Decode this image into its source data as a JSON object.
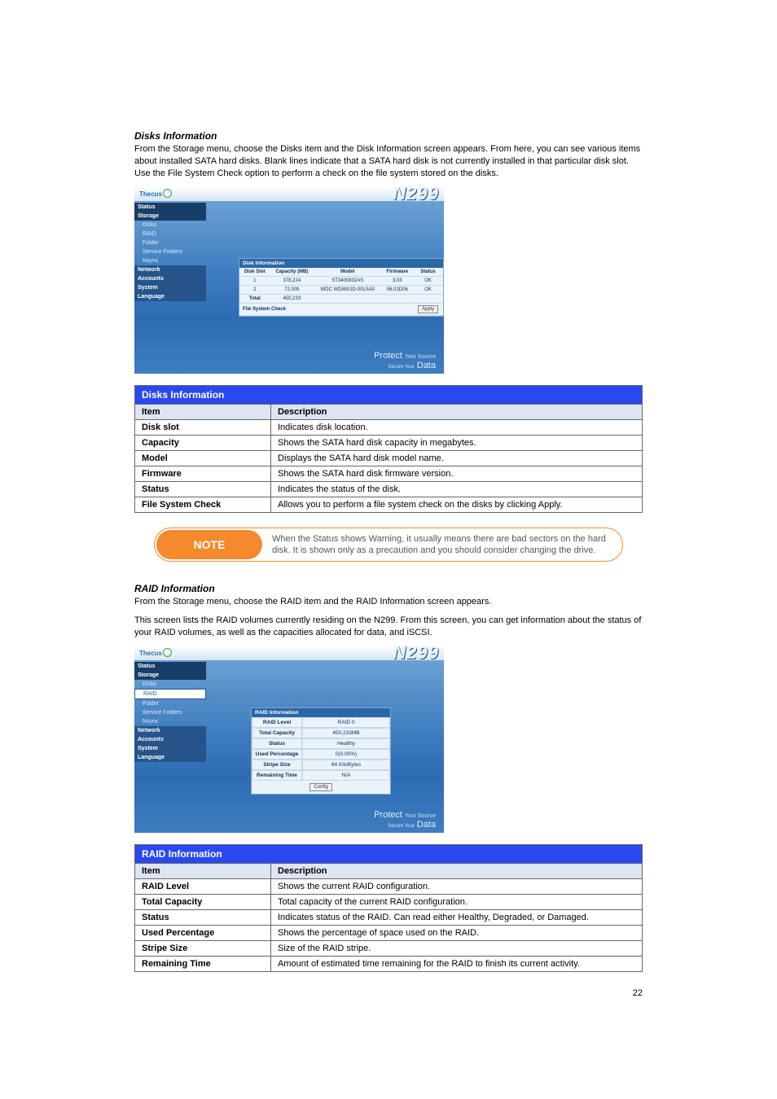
{
  "section1": {
    "num": "Disks Information",
    "desc": "From the Storage menu, choose the Disks item and the Disk Information screen appears. From here, you can see various items about installed SATA hard disks. Blank lines indicate that a SATA hard disk is not currently installed in that particular disk slot. Use the File System Check option to perform a check on the file system stored on the disks."
  },
  "screenshot1": {
    "logo": "Thecus",
    "model": "N299",
    "sidebar": {
      "status": "Status",
      "storage": "Storage",
      "subs": [
        "Disks",
        "RAID",
        "Folder",
        "Service Folders",
        "Nsync"
      ],
      "network": "Network",
      "accounts": "Accounts",
      "system": "System",
      "language": "Language"
    },
    "card_title": "Disk Information",
    "headers": [
      "Disk Slot",
      "Capacity (MB)",
      "Model",
      "Firmware",
      "Status"
    ],
    "rows": [
      [
        "1",
        "378,224",
        "ST3400832AS",
        "3.03",
        "OK"
      ],
      [
        "2",
        "72,009",
        "WDC WD800JD-00LSA0",
        "06.01D06",
        "OK"
      ]
    ],
    "total_label": "Total",
    "total_value": "450,233",
    "fsc_label": "File System Check",
    "apply": "Apply",
    "footer1": "Protect",
    "footer2": "Your Source",
    "footer3": "Secure Your",
    "footer4": "Data"
  },
  "table1": {
    "title": "Disks Information",
    "head_item": "Item",
    "head_desc": "Description",
    "rows": [
      [
        "Disk slot",
        "Indicates disk location."
      ],
      [
        "Capacity",
        "Shows the SATA hard disk capacity in megabytes."
      ],
      [
        "Model",
        "Displays the SATA hard disk model name."
      ],
      [
        "Firmware",
        "Shows the SATA hard disk firmware version."
      ],
      [
        "Status",
        "Indicates the status of the disk."
      ],
      [
        "File System Check",
        "Allows you to perform a file system check on the disks by clicking Apply."
      ]
    ]
  },
  "note": {
    "badge": "NOTE",
    "text": "When the Status shows Warning, it usually means there are bad sectors on the hard disk. It is shown only as a precaution and you should consider changing the drive."
  },
  "section2": {
    "num": "RAID Information",
    "desc_a": "From the Storage menu, choose the RAID item and the RAID Information screen appears.",
    "desc_b": "This screen lists the RAID volumes currently residing on the N299. From this screen, you can get information about the status of your RAID volumes, as well as the capacities allocated for data, and iSCSI."
  },
  "screenshot2": {
    "logo": "Thecus",
    "model": "N299",
    "sidebar": {
      "status": "Status",
      "storage": "Storage",
      "subs": [
        "Disks",
        "RAID",
        "Folder",
        "Service Folders",
        "Nsync"
      ],
      "active": "RAID",
      "network": "Network",
      "accounts": "Accounts",
      "system": "System",
      "language": "Language"
    },
    "card_title": "RAID Information",
    "fields": [
      [
        "RAID Level",
        "RAID 0"
      ],
      [
        "Total Capacity",
        "450,233MB"
      ],
      [
        "Status",
        "Healthy"
      ],
      [
        "Used Percentage",
        "0(0.00%)"
      ],
      [
        "Stripe Size",
        "64 KiloBytes"
      ],
      [
        "Remaining Time",
        "N/A"
      ]
    ],
    "config_btn": "Config",
    "footer1": "Protect",
    "footer2": "Your Source",
    "footer3": "Secure Your",
    "footer4": "Data"
  },
  "table2": {
    "title": "RAID Information",
    "head_item": "Item",
    "head_desc": "Description",
    "rows": [
      [
        "RAID Level",
        "Shows the current RAID configuration."
      ],
      [
        "Total Capacity",
        "Total capacity of the current RAID configuration."
      ],
      [
        "Status",
        "Indicates status of the RAID. Can read either Healthy, Degraded, or Damaged."
      ],
      [
        "Used Percentage",
        "Shows the percentage of space used on the RAID."
      ],
      [
        "Stripe Size",
        "Size of the RAID stripe."
      ],
      [
        "Remaining Time",
        "Amount of estimated time remaining for the RAID to finish its current activity."
      ]
    ]
  },
  "page_num": "22"
}
